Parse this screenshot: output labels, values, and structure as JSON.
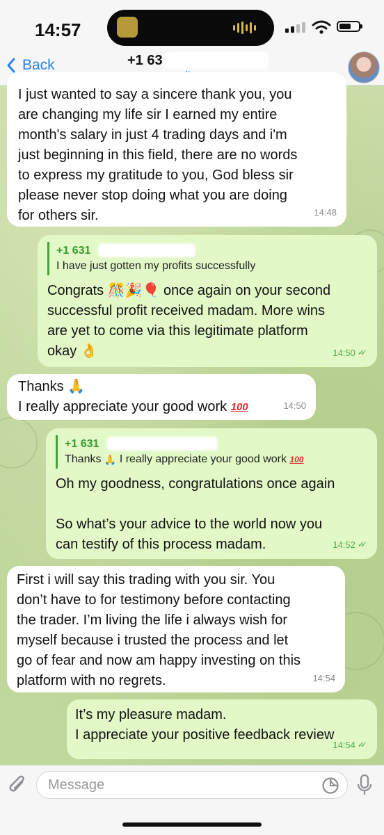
{
  "status_bar": {
    "time": "14:57"
  },
  "header": {
    "back_label": "Back",
    "contact_name": "+1 63",
    "contact_status": "online"
  },
  "messages": [
    {
      "direction": "in",
      "lines": [
        "I just wanted to say a sincere thank you, you",
        "are changing my life sir I earned my entire",
        "month's salary in just 4 trading days and i'm",
        "just beginning in this field, there are no words",
        "to express my gratitude to you, God bless sir",
        "please never stop doing what you are doing",
        "for others sir."
      ],
      "time": "14:48"
    },
    {
      "direction": "out",
      "reply_name": "+1 631",
      "reply_text": "I have just gotten my profits successfully",
      "lines": [
        "Congrats",
        "once again on your second",
        "successful profit received madam. More wins",
        "are yet to come via this legitimate platform",
        "okay"
      ],
      "time": "14:50"
    },
    {
      "direction": "in",
      "lines": [
        "Thanks",
        "I really appreciate your good work"
      ],
      "time": "14:50"
    },
    {
      "direction": "out",
      "reply_name": "+1 631",
      "reply_text_a": "Thanks",
      "reply_text_b": "I really appreciate your good work",
      "lines": [
        "Oh my goodness, congratulations once again",
        "So what’s your advice to the world now you",
        "can testify of this process madam."
      ],
      "time": "14:52"
    },
    {
      "direction": "in",
      "lines": [
        "First i will say this trading with you sir. You",
        "don’t have to for testimony before contacting",
        "the trader. I’m living the life i always wish for",
        "myself because i trusted the process and let",
        "go of fear and now am happy investing on this",
        "platform with no regrets."
      ],
      "time": "14:54"
    },
    {
      "direction": "out",
      "lines": [
        "It’s my pleasure madam.",
        "I appreciate your positive feedback review"
      ],
      "time": "14:54"
    }
  ],
  "composer": {
    "placeholder": "Message"
  },
  "colors": {
    "incoming_bubble": "#ffffff",
    "outgoing_bubble": "#e2f8c7",
    "accent_blue": "#2a82e4",
    "reply_green": "#3c9a33",
    "wallpaper": "#c7dca6"
  },
  "icons": [
    "back-chevron-icon",
    "paperclip-icon",
    "sticker-icon",
    "microphone-icon",
    "double-check-icon",
    "party-popper-emoji",
    "confetti-emoji",
    "balloon-emoji",
    "ok-hand-emoji",
    "folded-hands-emoji",
    "hundred-points-emoji"
  ]
}
